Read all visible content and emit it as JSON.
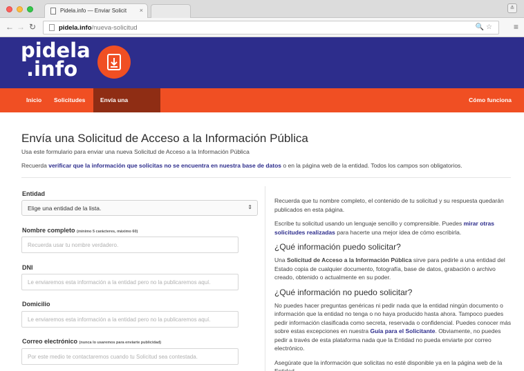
{
  "browser": {
    "tab_title": "Pidela.info — Enviar Solicit",
    "tab_close": "×",
    "url_host": "pidela.info",
    "url_path": "/nueva-solicitud"
  },
  "site": {
    "logo_line1": "pidela",
    "logo_line2": ".info",
    "accent_color": "#f04f23",
    "header_color": "#2d2d8c",
    "active_nav_color": "#8f2d14"
  },
  "nav": {
    "inicio": "Inicio",
    "solicitudes": "Solicitudes",
    "envia": "Envía una solicitud",
    "como_funciona": "Cómo funciona"
  },
  "page": {
    "title": "Envía una Solicitud de Acceso a la Información Pública",
    "subtitle": "Usa este formulario para enviar una nueva Solicitud de Acceso a la Información Pública",
    "reminder_prefix": "Recuerda ",
    "reminder_link": "verificar que la información que solicitas no se encuentra en nuestra base de datos",
    "reminder_suffix": " o en la página web de la entidad. Todos los campos son obligatorios."
  },
  "form": {
    "entidad_label": "Entidad",
    "entidad_value": "Elige una entidad de la lista.",
    "nombre_label": "Nombre completo",
    "nombre_hint": "(mínimo 5 carácteres, máximo 60)",
    "nombre_placeholder": "Recuerda usar tu nombre verdadero.",
    "dni_label": "DNI",
    "dni_placeholder": "Le enviaremos esta información a la entidad pero no la publicaremos aquí.",
    "domicilio_label": "Domicilio",
    "domicilio_placeholder": "Le enviaremos esta información a la entidad pero no la publicaremos aquí.",
    "correo_label": "Correo electrónico",
    "correo_hint": "(nunca lo usaremos para enviarte publicidad)",
    "correo_placeholder": "Por este medio te contactaremos cuando tu Solicitud sea contestada."
  },
  "sidebar": {
    "p1": "Recuerda que tu nombre completo, el contenido de tu solicitud y su respuesta quedarán publicados en esta página.",
    "p2_prefix": "Escribe tu solicitud usando un lenguaje sencillo y comprensible. Puedes ",
    "p2_link": "mirar otras solicitudes realizadas",
    "p2_suffix": " para hacerte una mejor idea de cómo escribirla.",
    "h1": "¿Qué información puedo solicitar?",
    "p3_prefix": "Una ",
    "p3_bold": "Solicitud de Acceso a la Información Pública",
    "p3_suffix": " sirve para pedirle a una entidad del Estado copia de cualquier documento, fotografía, base de datos, grabación o archivo creado, obtenido o actualmente en su poder.",
    "h2": "¿Qué información no puedo solicitar?",
    "p4_prefix": "No puedes hacer preguntas genéricas ni pedir nada que la entidad ningún documento o información que la entidad no tenga o no haya producido hasta ahora. Tampoco puedes pedir información clasificada como secreta, reservada o confidencial. Puedes conocer más sobre estas excepciones en nuestra ",
    "p4_link": "Guía para el Solicitante",
    "p4_suffix": ". Obviamente, no puedes pedir a través de esta plataforma nada que la Entidad no pueda enviarte por correo electrónico.",
    "p5": "Asegúrate que la información que solicitas no esté disponible ya en la página web de la Entidad."
  }
}
